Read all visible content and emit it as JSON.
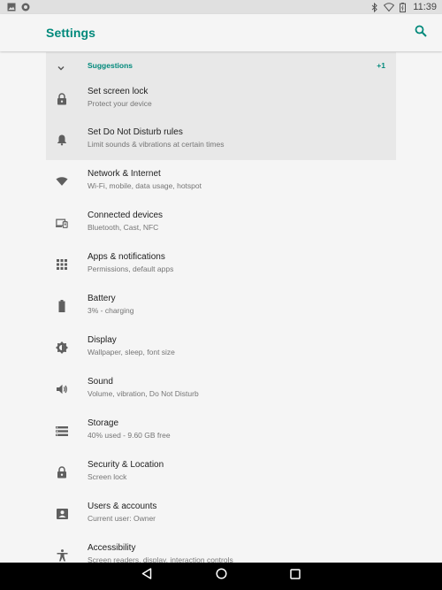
{
  "status_bar": {
    "time": "11:39"
  },
  "app_bar": {
    "title": "Settings"
  },
  "suggestions": {
    "label": "Suggestions",
    "count": "+1",
    "items": [
      {
        "title": "Set screen lock",
        "subtitle": "Protect your device",
        "icon": "lock-icon"
      },
      {
        "title": "Set Do Not Disturb rules",
        "subtitle": "Limit sounds & vibrations at certain times",
        "icon": "bell-icon"
      }
    ]
  },
  "settings": [
    {
      "title": "Network & Internet",
      "subtitle": "Wi-Fi, mobile, data usage, hotspot",
      "icon": "wifi-icon"
    },
    {
      "title": "Connected devices",
      "subtitle": "Bluetooth, Cast, NFC",
      "icon": "devices-icon"
    },
    {
      "title": "Apps & notifications",
      "subtitle": "Permissions, default apps",
      "icon": "apps-grid-icon"
    },
    {
      "title": "Battery",
      "subtitle": "3% - charging",
      "icon": "battery-icon"
    },
    {
      "title": "Display",
      "subtitle": "Wallpaper, sleep, font size",
      "icon": "brightness-icon"
    },
    {
      "title": "Sound",
      "subtitle": "Volume, vibration, Do Not Disturb",
      "icon": "volume-icon"
    },
    {
      "title": "Storage",
      "subtitle": "40% used - 9.60 GB free",
      "icon": "storage-icon"
    },
    {
      "title": "Security & Location",
      "subtitle": "Screen lock",
      "icon": "lock-icon"
    },
    {
      "title": "Users & accounts",
      "subtitle": "Current user: Owner",
      "icon": "account-icon"
    },
    {
      "title": "Accessibility",
      "subtitle": "Screen readers, display, interaction controls",
      "icon": "accessibility-icon"
    }
  ],
  "colors": {
    "accent": "#00897b",
    "suggestion_bg": "#e8e8e8",
    "background": "#f5f5f5",
    "icon": "#5f5f5f"
  }
}
